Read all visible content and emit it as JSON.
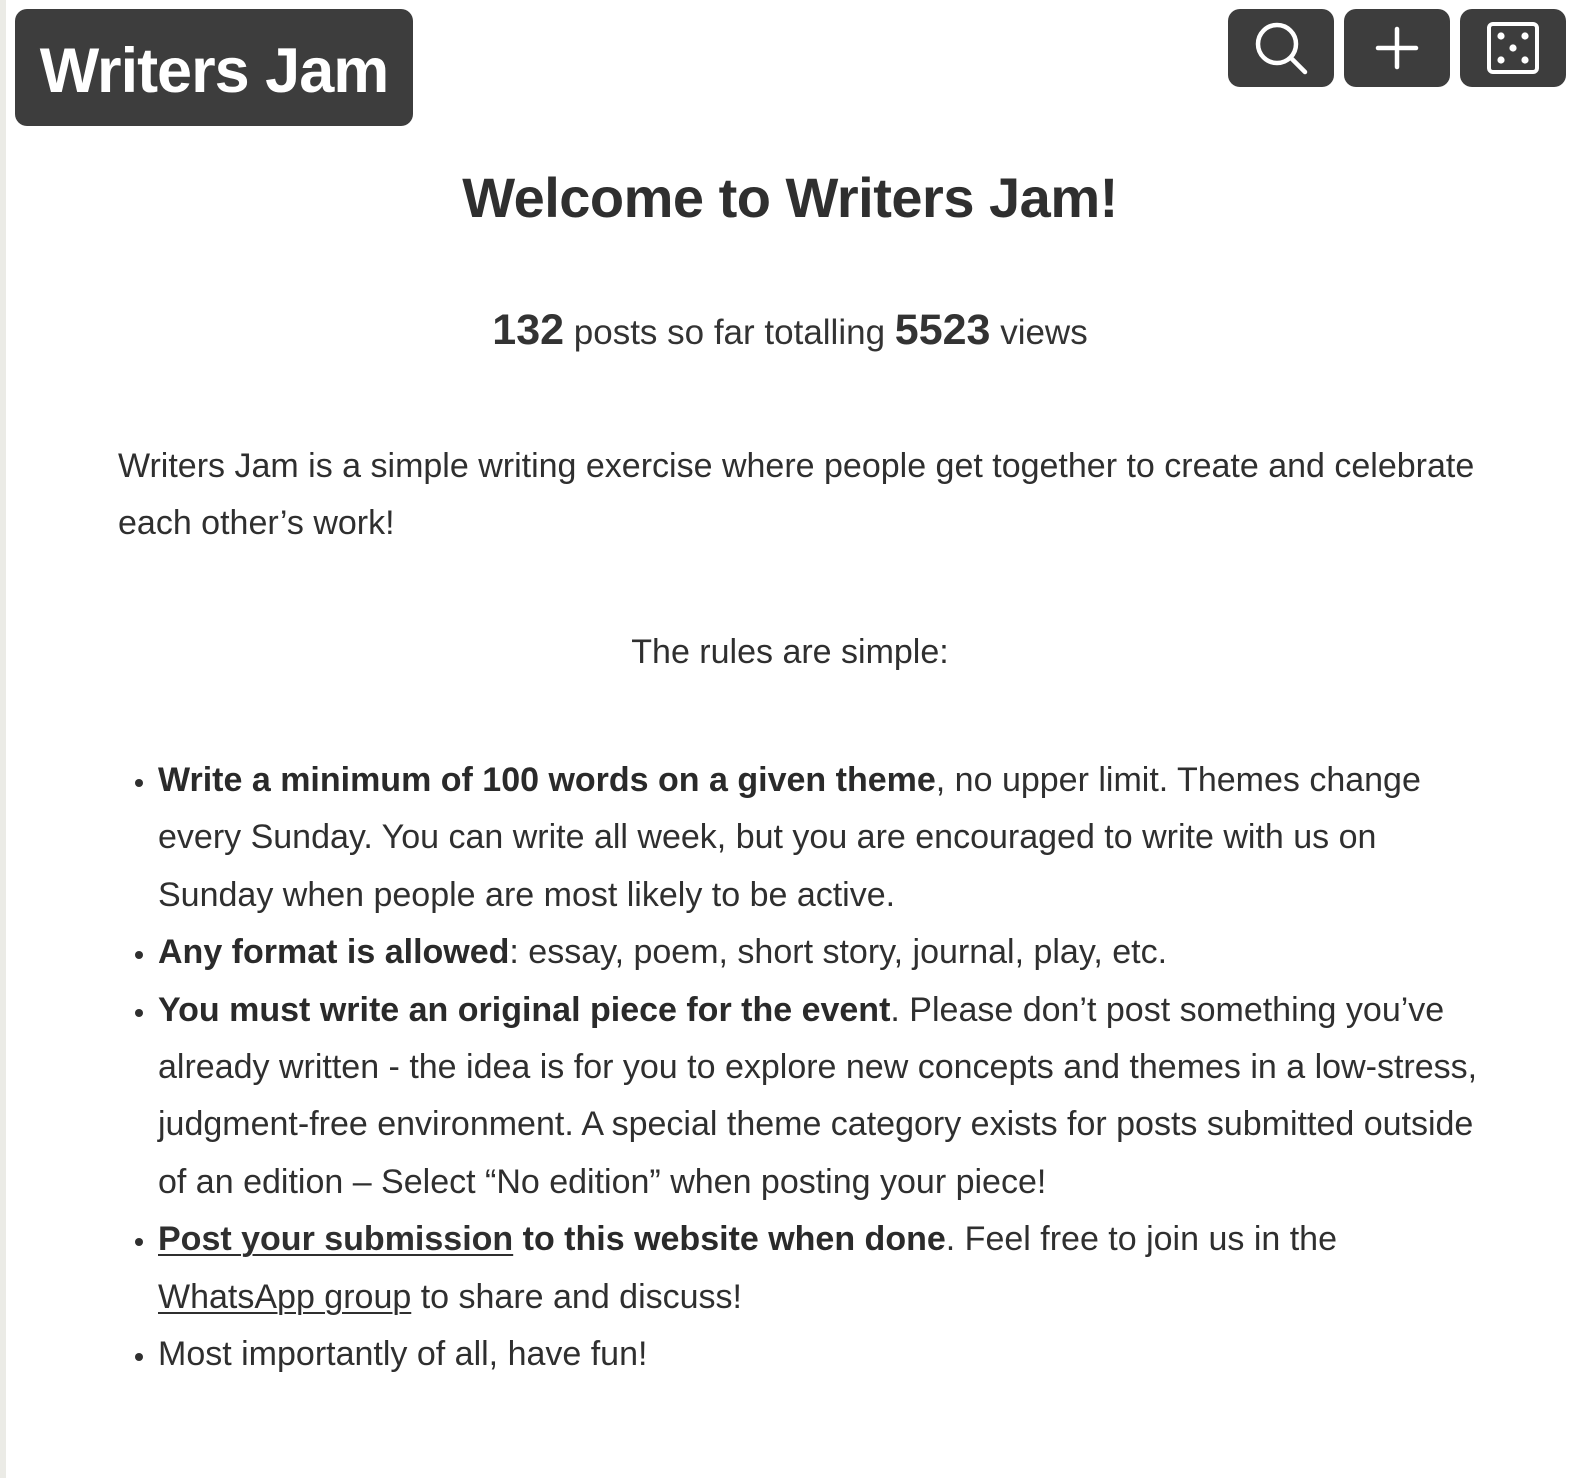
{
  "header": {
    "logo_text": "Writers Jam",
    "buttons": [
      {
        "name": "search",
        "icon": "search-icon"
      },
      {
        "name": "new-post",
        "icon": "plus-icon"
      },
      {
        "name": "random-post",
        "icon": "dice-icon"
      }
    ]
  },
  "main": {
    "title": "Welcome to Writers Jam!",
    "stats": {
      "posts_count": "132",
      "posts_label": "posts so far totalling",
      "views_count": "5523",
      "views_label": "views"
    },
    "intro": "Writers Jam is a simple writing exercise where people get together to create and celebrate each other’s work!",
    "rules_intro": "The rules are simple:",
    "rules": [
      {
        "bold": "Write a minimum of 100 words on a given theme",
        "text": ", no upper limit. Themes change every Sunday. You can write all week, but you are encouraged to write with us on Sunday when people are most likely to be active."
      },
      {
        "bold": "Any format is allowed",
        "text": ": essay, poem, short story, journal, play, etc."
      },
      {
        "bold": "You must write an original piece for the event",
        "text": ". Please don’t post something you’ve already written - the idea is for you to explore new concepts and themes in a low-stress, judgment-free environment. A special theme category exists for posts submitted outside of an edition – Select “No edition” when posting your piece!"
      },
      {
        "link": "Post your submission",
        "bold": " to this website when done",
        "text": ". Feel free to join us in the ",
        "link2": "WhatsApp group",
        "text2": " to share and discuss!"
      },
      {
        "text": "Most importantly of all, have fun!"
      }
    ]
  },
  "colors": {
    "button_bg": "#3d3d3d",
    "text": "#2f2f2f",
    "background": "#ffffff"
  }
}
